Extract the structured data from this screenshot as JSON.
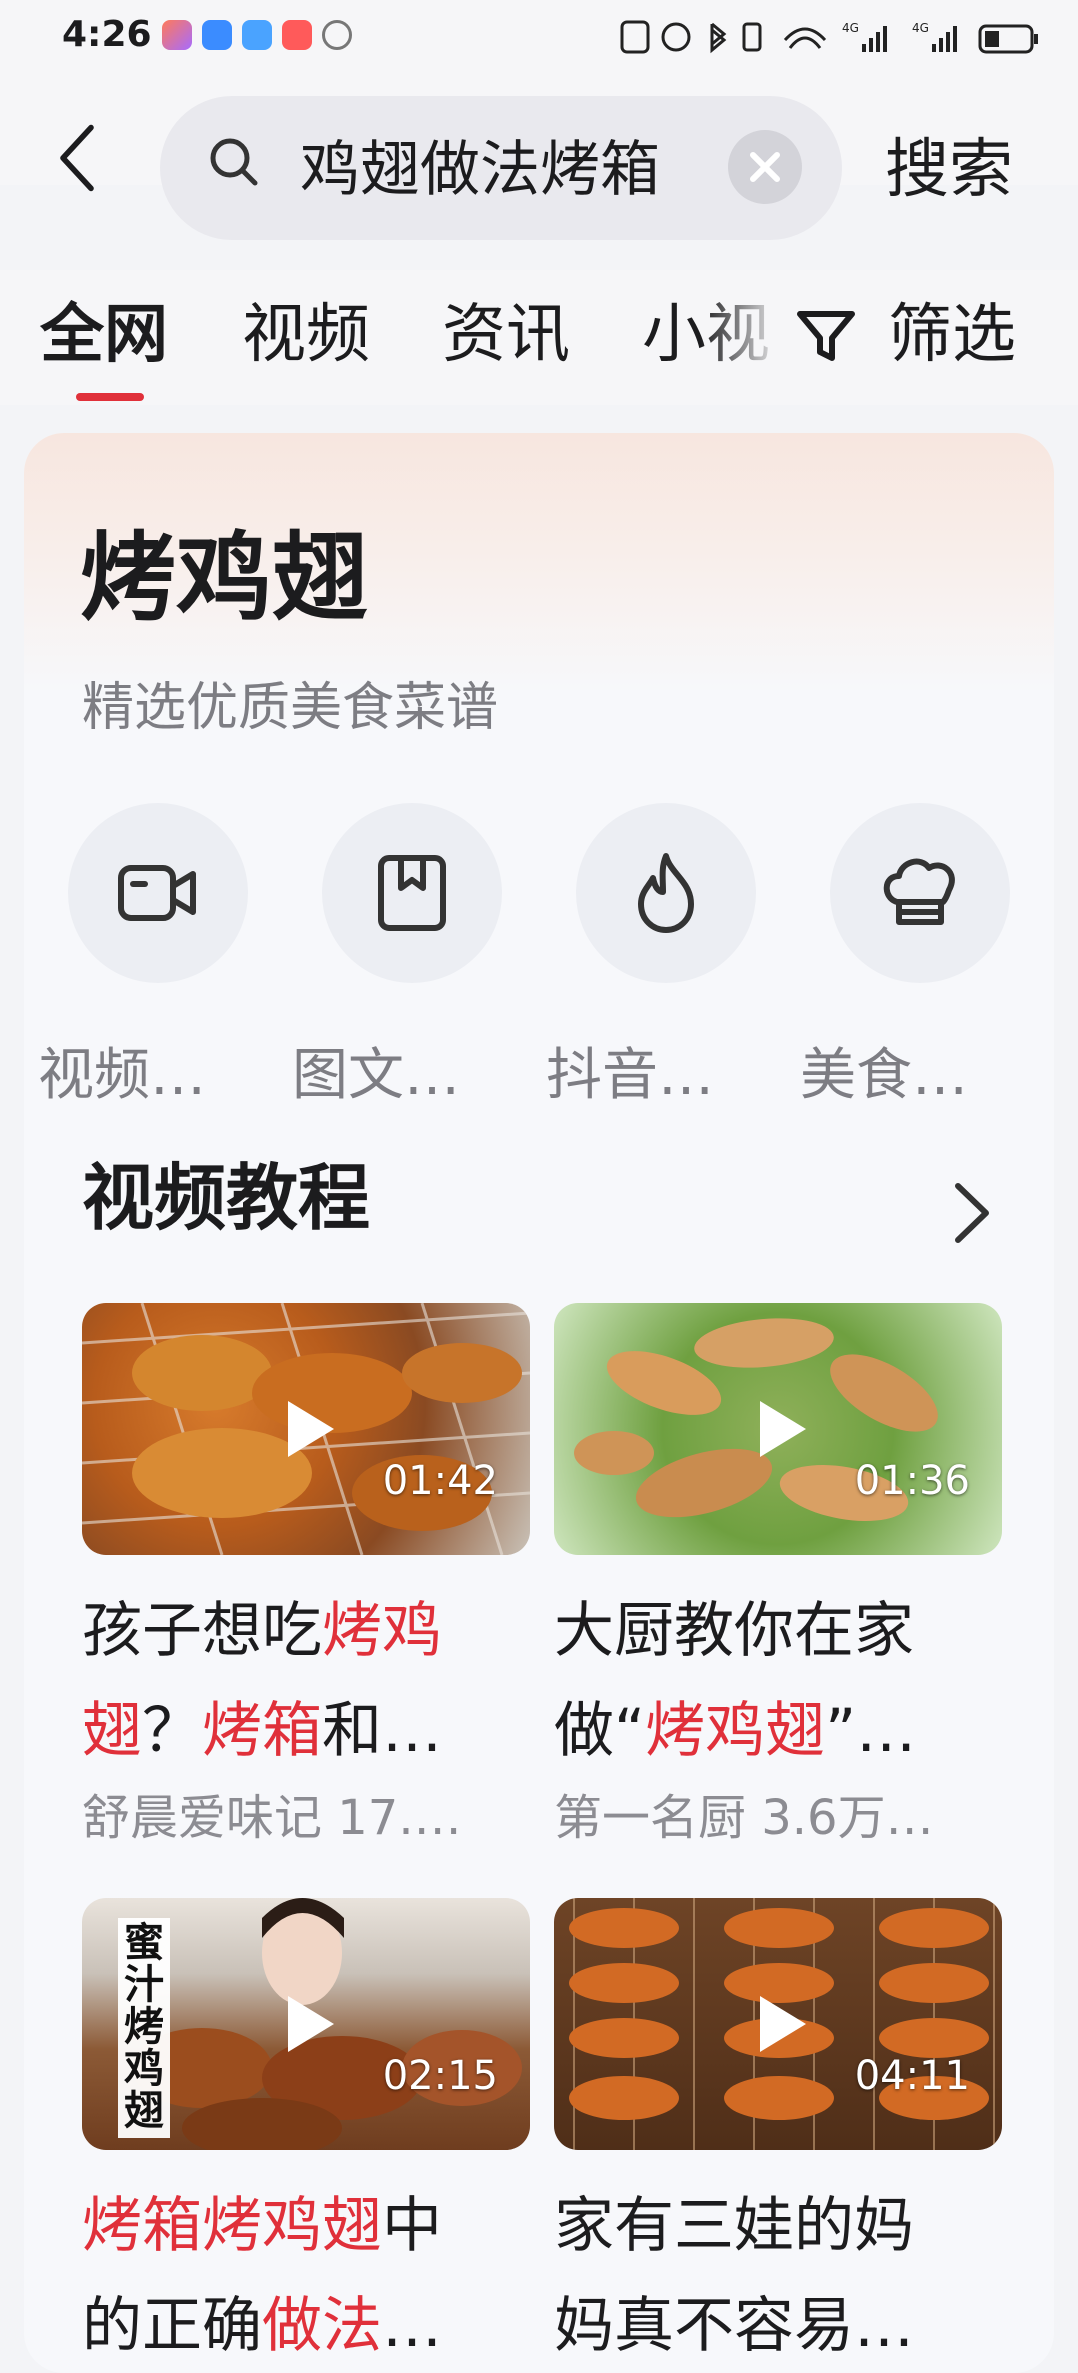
{
  "status_bar": {
    "time": "4:26",
    "icons": [
      "nfc-icon",
      "alarm-icon",
      "bluetooth-icon",
      "vibrate-icon",
      "wifi-icon",
      "signal-4g-icon",
      "signal-4g-icon",
      "battery-icon"
    ],
    "net_labels": [
      "4G",
      "4G"
    ]
  },
  "header": {
    "search_query": "鸡翅做法烤箱",
    "search_button": "搜索"
  },
  "tabs": {
    "items": [
      "全网",
      "视频",
      "资讯",
      "小视"
    ],
    "active": "全网",
    "filter_label": "筛选",
    "accent_color": "#e0303a"
  },
  "card": {
    "title": "烤鸡翅",
    "subtitle": "精选优质美食菜谱",
    "categories": [
      {
        "icon": "video-camera-icon",
        "label": "视频…"
      },
      {
        "icon": "bookmark-icon",
        "label": "图文…"
      },
      {
        "icon": "flame-icon",
        "label": "抖音…"
      },
      {
        "icon": "chef-hat-icon",
        "label": "美食…"
      }
    ],
    "section_title": "视频教程",
    "videos": [
      {
        "duration": "01:42",
        "title_parts": [
          [
            "孩子想吃",
            false
          ],
          [
            "烤鸡",
            true
          ],
          [
            "翅",
            true
          ],
          [
            "？",
            false
          ],
          [
            "烤箱",
            true
          ],
          [
            "和…",
            false
          ]
        ],
        "meta": "舒晨爱味记  17.…"
      },
      {
        "duration": "01:36",
        "title_parts": [
          [
            "大厨教你在家",
            false
          ],
          [
            "做“",
            false
          ],
          [
            "烤鸡翅",
            true
          ],
          [
            "”…",
            false
          ]
        ],
        "meta": "第一名厨  3.6万…"
      },
      {
        "duration": "02:15",
        "overlay_text": "蜜汁烤鸡翅",
        "title_parts": [
          [
            "烤箱烤鸡翅",
            true
          ],
          [
            "中",
            false
          ],
          [
            "的正确",
            false
          ],
          [
            "做法",
            true
          ],
          [
            "…",
            false
          ]
        ],
        "meta": ""
      },
      {
        "duration": "04:11",
        "title_parts": [
          [
            "家有三娃的妈",
            false
          ],
          [
            "妈真不容易…",
            false
          ]
        ],
        "meta": ""
      }
    ]
  }
}
